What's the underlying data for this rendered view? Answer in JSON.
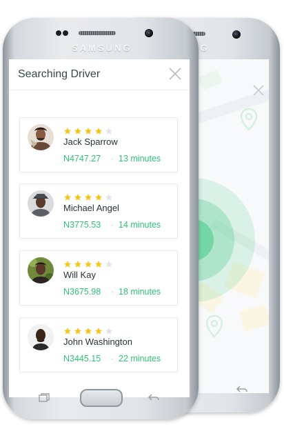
{
  "device": {
    "brand": "SAMSUNG"
  },
  "header": {
    "title": "Searching Driver"
  },
  "colors": {
    "accent": "#2ec477",
    "star_filled": "#f5c518",
    "star_empty": "#dfe3e6"
  },
  "drivers": [
    {
      "name": "Jack Sparrow",
      "rating": 4,
      "max_rating": 5,
      "fare": "N4747.27",
      "separator": "·",
      "eta": "13 minutes"
    },
    {
      "name": "Michael Angel",
      "rating": 4,
      "max_rating": 5,
      "fare": "N3775.53",
      "separator": "·",
      "eta": "14 minutes"
    },
    {
      "name": "Will Kay",
      "rating": 4,
      "max_rating": 5,
      "fare": "N3675.98",
      "separator": "·",
      "eta": "18 minutes"
    },
    {
      "name": "John Washington",
      "rating": 4,
      "max_rating": 5,
      "fare": "N3445.15",
      "separator": "·",
      "eta": "22 minutes"
    }
  ],
  "icons": {
    "close": "close-icon",
    "star": "star-icon",
    "recent_apps": "recent-apps-icon",
    "back": "back-icon",
    "map_pin": "map-pin-icon"
  }
}
